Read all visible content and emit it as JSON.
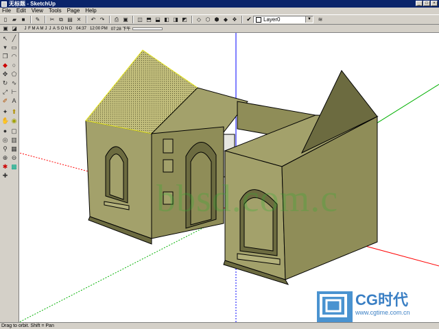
{
  "window": {
    "title": "无标题 - SketchUp"
  },
  "menu": [
    "File",
    "Edit",
    "View",
    "Tools",
    "Page",
    "Help"
  ],
  "layers": {
    "current": "Layer0"
  },
  "shadow": {
    "months": [
      "J",
      "F",
      "M",
      "A",
      "M",
      "J",
      "J",
      "A",
      "S",
      "O",
      "N",
      "D"
    ],
    "time_start": "04:37",
    "time_noon": "12:00 PM",
    "time_end": "07:28 下午"
  },
  "status": {
    "text": "Drag to orbit.  Shift = Pan"
  },
  "watermark": {
    "text": "bbsd.com.c"
  },
  "logo": {
    "brand": "CG时代",
    "url": "www.cgtime.com.cn"
  },
  "colors": {
    "wall": "#a3a16b",
    "wall_dark": "#6c6b40",
    "roof": "#c3bf7d",
    "axis_red": "#ff0000",
    "axis_green": "#00b000",
    "axis_blue": "#0000ff"
  }
}
